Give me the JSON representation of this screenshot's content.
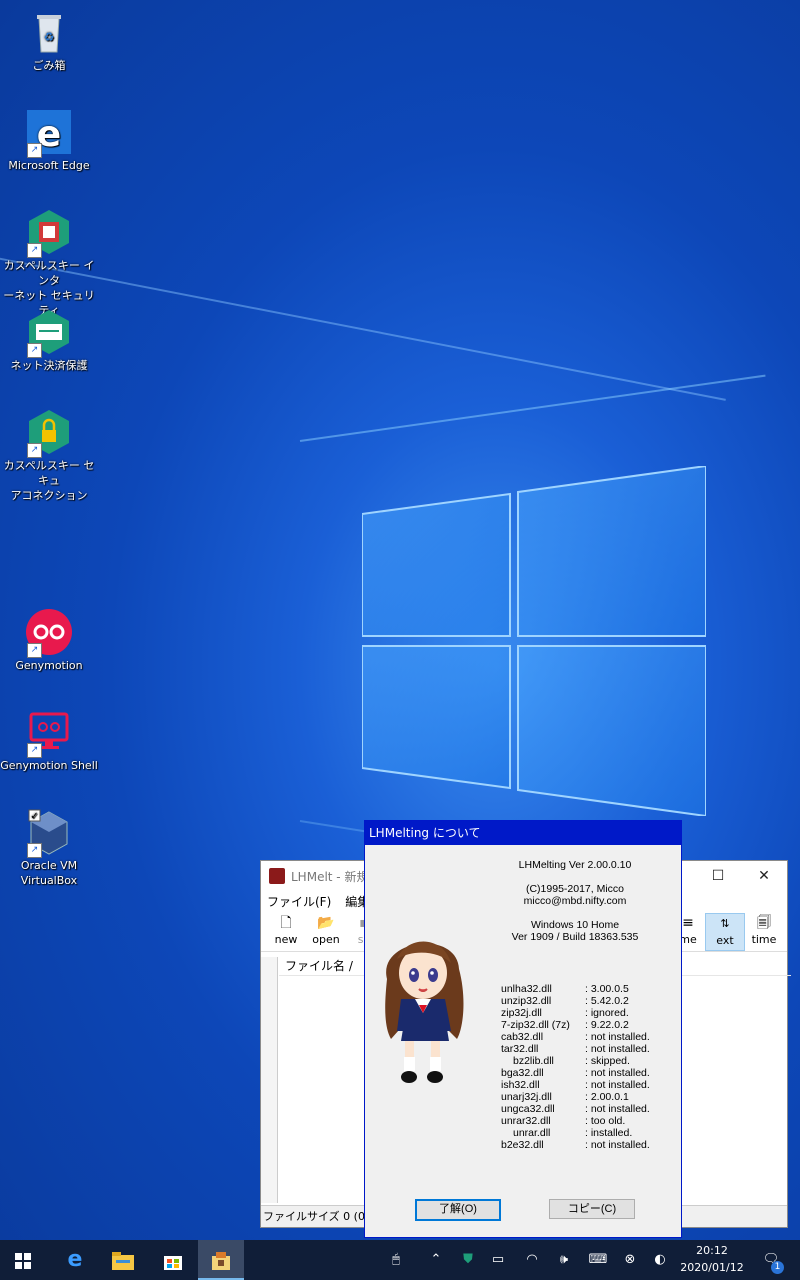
{
  "desktop": {
    "icons": [
      {
        "label_lines": [
          "ごみ箱"
        ],
        "icon": "recycle-bin-icon"
      },
      {
        "label_lines": [
          "Microsoft Edge"
        ],
        "icon": "edge-icon"
      },
      {
        "label_lines": [
          "カスペルスキー インタ",
          "ーネット セキュリティ"
        ],
        "icon": "kaspersky-icon"
      },
      {
        "label_lines": [
          "ネット決済保護"
        ],
        "icon": "safe-money-icon"
      },
      {
        "label_lines": [
          "カスペルスキー セキュ",
          "アコネクション"
        ],
        "icon": "secure-connection-icon"
      },
      {
        "label_lines": [
          "Genymotion"
        ],
        "icon": "genymotion-icon"
      },
      {
        "label_lines": [
          "Genymotion Shell"
        ],
        "icon": "genymotion-shell-icon"
      },
      {
        "label_lines": [
          "Oracle VM",
          "VirtualBox"
        ],
        "icon": "virtualbox-icon"
      }
    ]
  },
  "main_window": {
    "title": "LHMelt - 新規",
    "menu": [
      "ファイル(F)",
      "編集(E)"
    ],
    "toolbar": {
      "new": "new",
      "open": "open",
      "save": "sa",
      "name": "me",
      "ext": "ext",
      "time": "time"
    },
    "column_header": "ファイル名 /",
    "status": "ファイルサイズ 0 (0) バ",
    "controls": {
      "minimize": "—",
      "maximize": "☐",
      "close": "✕"
    }
  },
  "about_dialog": {
    "title": "LHMelting について",
    "info": {
      "version": "LHMelting Ver 2.00.0.10",
      "copyright": "(C)1995-2017, Micco",
      "email": "micco@mbd.nifty.com",
      "os": "Windows 10 Home",
      "build": "Ver 1909 / Build 18363.535"
    },
    "dlls": [
      {
        "name": "unlha32.dll",
        "status": ": 3.00.0.5"
      },
      {
        "name": "unzip32.dll",
        "status": ": 5.42.0.2"
      },
      {
        "name": "zip32j.dll",
        "status": ": ignored."
      },
      {
        "name": "7-zip32.dll (7z)",
        "status": ": 9.22.0.2"
      },
      {
        "name": "cab32.dll",
        "status": ": not installed."
      },
      {
        "name": "tar32.dll",
        "status": ": not installed."
      },
      {
        "name": "bz2lib.dll",
        "status": ": skipped."
      },
      {
        "name": "bga32.dll",
        "status": ": not installed."
      },
      {
        "name": "ish32.dll",
        "status": ": not installed."
      },
      {
        "name": "unarj32j.dll",
        "status": ": 2.00.0.1"
      },
      {
        "name": "ungca32.dll",
        "status": ": not installed."
      },
      {
        "name": "unrar32.dll",
        "status": ": too old."
      },
      {
        "name": "unrar.dll",
        "status": ": installed."
      },
      {
        "name": "b2e32.dll",
        "status": ": not installed."
      }
    ],
    "ok_label": "了解(O)",
    "copy_label": "コピー(C)"
  },
  "taskbar": {
    "time": "20:12",
    "date": "2020/01/12",
    "notification_count": "1"
  },
  "colors": {
    "dialog_caption": "#0019c8",
    "taskbar": "#101e38"
  }
}
